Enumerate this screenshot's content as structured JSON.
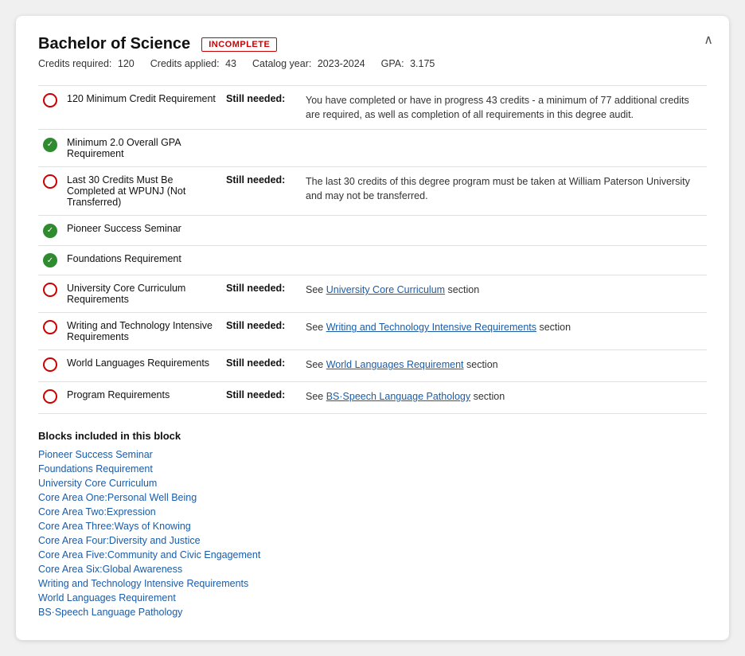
{
  "header": {
    "title": "Bachelor of Science",
    "badge": "INCOMPLETE",
    "meta": {
      "credits_required_label": "Credits required:",
      "credits_required_value": "120",
      "credits_applied_label": "Credits applied:",
      "credits_applied_value": "43",
      "catalog_year_label": "Catalog year:",
      "catalog_year_value": "2023-2024",
      "gpa_label": "GPA:",
      "gpa_value": "3.175"
    }
  },
  "requirements": [
    {
      "id": "req-1",
      "status": "incomplete",
      "name": "120 Minimum Credit Requirement",
      "still_needed": "Still needed:",
      "description": "You have completed or have in progress 43 credits - a minimum of 77 additional credits are required, as well as completion of all requirements in this degree audit.",
      "has_link": false
    },
    {
      "id": "req-2",
      "status": "complete",
      "name": "Minimum 2.0 Overall GPA Requirement",
      "still_needed": "",
      "description": "",
      "has_link": false
    },
    {
      "id": "req-3",
      "status": "incomplete",
      "name": "Last 30 Credits Must Be Completed at WPUNJ (Not Transferred)",
      "still_needed": "Still needed:",
      "description": "The last 30 credits of this degree program must be taken at William Paterson University and may not be transferred.",
      "has_link": false
    },
    {
      "id": "req-4",
      "status": "complete",
      "name": "Pioneer Success Seminar",
      "still_needed": "",
      "description": "",
      "has_link": false
    },
    {
      "id": "req-5",
      "status": "complete",
      "name": "Foundations Requirement",
      "still_needed": "",
      "description": "",
      "has_link": false
    },
    {
      "id": "req-6",
      "status": "incomplete",
      "name": "University Core Curriculum Requirements",
      "still_needed": "Still needed:",
      "description": "See ",
      "link_text": "University Core Curriculum",
      "link_suffix": " section",
      "has_link": true
    },
    {
      "id": "req-7",
      "status": "incomplete",
      "name": "Writing and Technology Intensive Requirements",
      "still_needed": "Still needed:",
      "description": "See ",
      "link_text": "Writing and Technology Intensive Requirements",
      "link_suffix": " section",
      "has_link": true
    },
    {
      "id": "req-8",
      "status": "incomplete",
      "name": "World Languages Requirements",
      "still_needed": "Still needed:",
      "description": "See ",
      "link_text": "World Languages Requirement",
      "link_suffix": " section",
      "has_link": true
    },
    {
      "id": "req-9",
      "status": "incomplete",
      "name": "Program Requirements",
      "still_needed": "Still needed:",
      "description": "See ",
      "link_text": "BS·Speech Language Pathology",
      "link_suffix": " section",
      "has_link": true
    }
  ],
  "blocks": {
    "title": "Blocks included in this block",
    "items": [
      "Pioneer Success Seminar",
      "Foundations Requirement",
      "University Core Curriculum",
      "Core Area One:Personal Well Being",
      "Core Area Two:Expression",
      "Core Area Three:Ways of Knowing",
      "Core Area Four:Diversity and Justice",
      "Core Area Five:Community and Civic Engagement",
      "Core Area Six:Global Awareness",
      "Writing and Technology Intensive Requirements",
      "World Languages Requirement",
      "BS·Speech Language Pathology"
    ]
  },
  "ui": {
    "collapse_icon": "∧",
    "checkmark": "✓",
    "circle_empty": ""
  }
}
